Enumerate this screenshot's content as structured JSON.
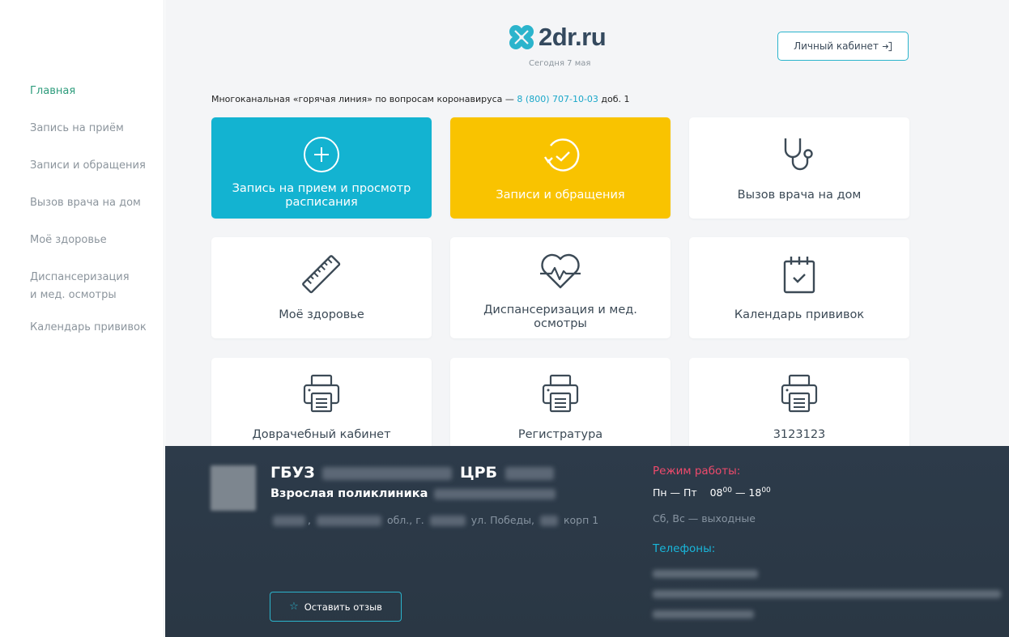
{
  "sidebar": {
    "items": [
      {
        "label": "Главная",
        "active": true
      },
      {
        "label": "Запись на приём"
      },
      {
        "label": "Записи и обращения"
      },
      {
        "label": "Вызов врача на дом"
      },
      {
        "label": "Моё здоровье"
      },
      {
        "label": "Диспансеризация"
      },
      {
        "label": "и мед. осмотры"
      },
      {
        "label": "Календарь прививок"
      }
    ]
  },
  "header": {
    "logo_text": "2dr.ru",
    "today": "Сегодня 7 мая",
    "cabinet_label": "Личный кабинет",
    "hotline_text": "Многоканальная «горячая линия» по вопросам коронавируса — ",
    "hotline_phone": "8 (800) 707-10-03",
    "hotline_ext": " доб. 1"
  },
  "tiles": [
    {
      "label": "Запись на прием и просмотр расписания",
      "icon": "plus-circle-icon",
      "color": "#13b3d1"
    },
    {
      "label": "Записи и обращения",
      "icon": "history-check-icon",
      "color": "#f9c300"
    },
    {
      "label": "Вызов врача на дом",
      "icon": "stethoscope-icon"
    },
    {
      "label": "Моё здоровье",
      "icon": "ruler-icon"
    },
    {
      "label": "Диспансеризация и мед. осмотры",
      "icon": "heart-pulse-icon"
    },
    {
      "label": "Календарь прививок",
      "icon": "calendar-check-icon"
    },
    {
      "label": "Доврачебный кабинет",
      "icon": "printer-icon"
    },
    {
      "label": "Регистратура",
      "icon": "printer-icon"
    },
    {
      "label": "3123123",
      "icon": "printer-icon"
    }
  ],
  "footer": {
    "clinic_prefix": "ГБУЗ",
    "clinic_suffix": "ЦРБ",
    "clinic_sub": "Взрослая поликлиника",
    "addr_sep": ",",
    "addr_region": "обл., г.",
    "addr_street": "ул. Победы,",
    "addr_corp": "корп 1",
    "review_label": "Оставить отзыв",
    "hours_title": "Режим работы:",
    "hours_days": "Пн — Пт",
    "hours_from": "08",
    "hours_to": "18",
    "hours_min": "00",
    "hours_weekend": "Сб, Вс — выходные",
    "phones_title": "Телефоны:"
  },
  "colors": {
    "accent": "#13b3d1",
    "yellow": "#f9c300",
    "active_nav": "#2e9c7c",
    "hours_title": "#ef4a6c",
    "phones_title": "#19b6da",
    "footer_bg": "#2d3b4a"
  }
}
